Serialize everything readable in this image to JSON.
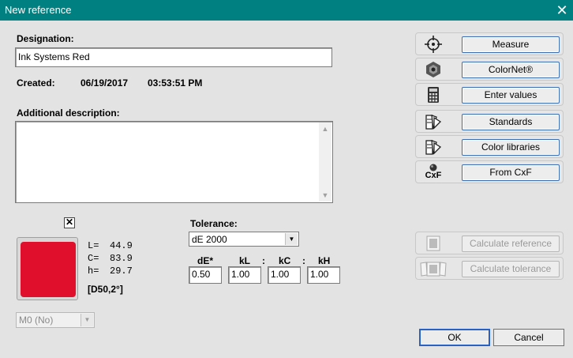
{
  "window": {
    "title": "New reference",
    "close_glyph": "✕"
  },
  "designation": {
    "label": "Designation:",
    "value": "Ink Systems Red"
  },
  "created": {
    "label": "Created:",
    "date": "06/19/2017",
    "time": "03:53:51 PM"
  },
  "additional": {
    "label": "Additional description:",
    "value": ""
  },
  "color": {
    "swatch_hex": "#e0102c",
    "check_glyph": "✕",
    "lch": [
      {
        "key": "L=",
        "value": "44.9"
      },
      {
        "key": "C=",
        "value": "83.9"
      },
      {
        "key": "h=",
        "value": "29.7"
      }
    ],
    "illuminant": "[D50,2°]",
    "mode": "M0 (No)"
  },
  "tolerance": {
    "label": "Tolerance:",
    "method": "dE 2000",
    "headers": {
      "de": "dE*",
      "kl": "kL",
      "kc": "kC",
      "kh": "kH",
      "sep": ":"
    },
    "values": {
      "de": "0.50",
      "kl": "1.00",
      "kc": "1.00",
      "kh": "1.00"
    }
  },
  "commands": [
    {
      "label": "Measure",
      "icon": "crosshair-icon",
      "enabled": true
    },
    {
      "label": "ColorNet®",
      "icon": "colornet-icon",
      "enabled": true
    },
    {
      "label": "Enter values",
      "icon": "calculator-icon",
      "enabled": true
    },
    {
      "label": "Standards",
      "icon": "fan-deck-icon",
      "enabled": true
    },
    {
      "label": "Color libraries",
      "icon": "fan-deck-icon",
      "enabled": true
    },
    {
      "label": "From CxF",
      "icon": "cxf-icon",
      "enabled": true,
      "icon_text": "CxF"
    }
  ],
  "calc": [
    {
      "label": "Calculate reference",
      "icon": "reference-icon",
      "enabled": false
    },
    {
      "label": "Calculate tolerance",
      "icon": "tolerance-icon",
      "enabled": false
    }
  ],
  "footer": {
    "ok": "OK",
    "cancel": "Cancel"
  }
}
